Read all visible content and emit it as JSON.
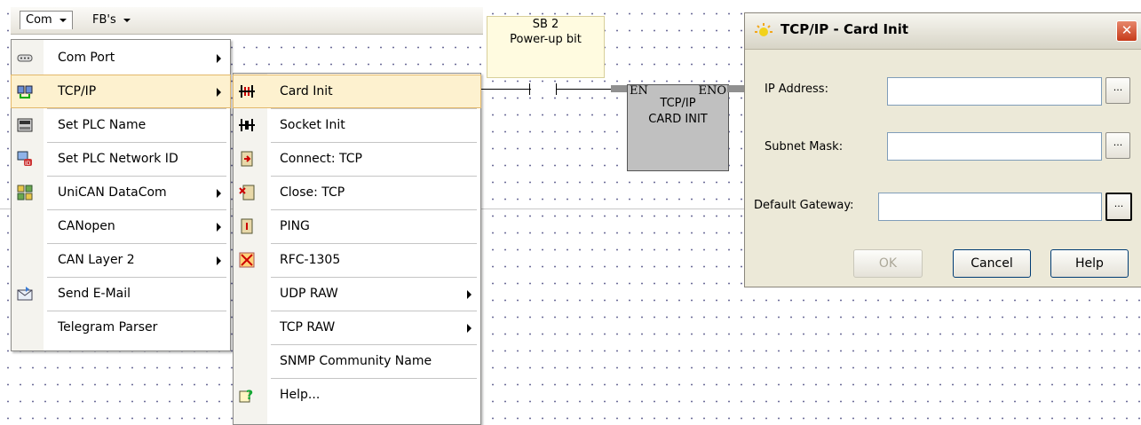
{
  "menubar": {
    "com": "Com",
    "fbs": "FB's"
  },
  "com_menu": [
    {
      "label": "Com Port",
      "icon": "com-port-icon",
      "submenu": true
    },
    {
      "label": "TCP/IP",
      "icon": "network-icon",
      "submenu": true,
      "active": true
    },
    {
      "label": "Set PLC Name",
      "icon": "plc-name-icon",
      "submenu": false
    },
    {
      "label": "Set PLC Network ID",
      "icon": "network-id-icon",
      "submenu": false
    },
    {
      "label": "UniCAN DataCom",
      "icon": "unican-icon",
      "submenu": true
    },
    {
      "label": "CANopen",
      "icon": "",
      "submenu": true
    },
    {
      "label": "CAN Layer 2",
      "icon": "",
      "submenu": true
    },
    {
      "label": "Send E-Mail",
      "icon": "email-icon",
      "submenu": false
    },
    {
      "label": "Telegram Parser",
      "icon": "",
      "submenu": false
    }
  ],
  "tcp_menu": [
    {
      "label": "Card Init",
      "icon": "card-init-icon",
      "submenu": false,
      "active": true
    },
    {
      "label": "Socket Init",
      "icon": "socket-init-icon",
      "submenu": false
    },
    {
      "label": "Connect: TCP",
      "icon": "connect-icon",
      "submenu": false
    },
    {
      "label": "Close: TCP",
      "icon": "close-connection-icon",
      "submenu": false
    },
    {
      "label": "PING",
      "icon": "ping-icon",
      "submenu": false
    },
    {
      "label": "RFC-1305",
      "icon": "rfc-icon",
      "submenu": false
    },
    {
      "label": "UDP RAW",
      "icon": "",
      "submenu": true
    },
    {
      "label": "TCP RAW",
      "icon": "",
      "submenu": true
    },
    {
      "label": "SNMP Community Name",
      "icon": "",
      "submenu": false
    },
    {
      "label": "Help...",
      "icon": "help-icon",
      "submenu": false
    }
  ],
  "ladder": {
    "comment_line1": "SB 2",
    "comment_line2": "Power-up bit",
    "fb_en": "EN",
    "fb_eno": "ENO",
    "fb_title1": "TCP/IP",
    "fb_title2": "CARD INIT"
  },
  "dialog": {
    "title": "TCP/IP - Card Init",
    "close": "✕",
    "ip_label": "IP Address:",
    "subnet_label": "Subnet Mask:",
    "gateway_label": "Default Gateway:",
    "ip_value": "",
    "subnet_value": "",
    "gateway_value": "",
    "browse": "...",
    "ok": "OK",
    "cancel": "Cancel",
    "help": "Help"
  },
  "colors": {
    "highlight": "#fdf1cf",
    "fb_block": "#c0c0c0",
    "dialog_bg": "#ece9d8"
  }
}
